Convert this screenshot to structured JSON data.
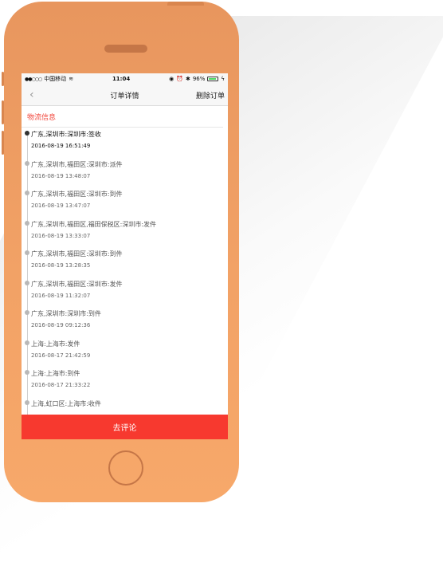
{
  "status_bar": {
    "carrier": "中国移动",
    "time": "11:04",
    "battery": "96%",
    "battery_color": "#4cd964"
  },
  "navbar": {
    "title": "订单详情",
    "action": "删除订单",
    "back_icon": "chevron-left-icon"
  },
  "section": {
    "title": "物流信息",
    "accent_color": "#f2473c"
  },
  "events": [
    {
      "location": "广东,深圳市:深圳市:签收",
      "time": "2016-08-19 16:51:49",
      "active": true
    },
    {
      "location": "广东,深圳市,福田区:深圳市:派件",
      "time": "2016-08-19 13:48:07"
    },
    {
      "location": "广东,深圳市,福田区:深圳市:到件",
      "time": "2016-08-19 13:47:07"
    },
    {
      "location": "广东,深圳市,福田区,福田保税区:深圳市:发件",
      "time": "2016-08-19 13:33:07"
    },
    {
      "location": "广东,深圳市,福田区:深圳市:到件",
      "time": "2016-08-19 13:28:35"
    },
    {
      "location": "广东,深圳市,福田区:深圳市:发件",
      "time": "2016-08-19 11:32:07"
    },
    {
      "location": "广东,深圳市:深圳市:到件",
      "time": "2016-08-19 09:12:36"
    },
    {
      "location": "上海:上海市:发件",
      "time": "2016-08-17 21:42:59"
    },
    {
      "location": "上海:上海市:到件",
      "time": "2016-08-17 21:33:22"
    },
    {
      "location": "上海,虹口区:上海市:收件",
      "time": ""
    }
  ],
  "bottom_button": {
    "label": "去评论",
    "color": "#f7392f"
  },
  "phone_color": "#f2a266"
}
